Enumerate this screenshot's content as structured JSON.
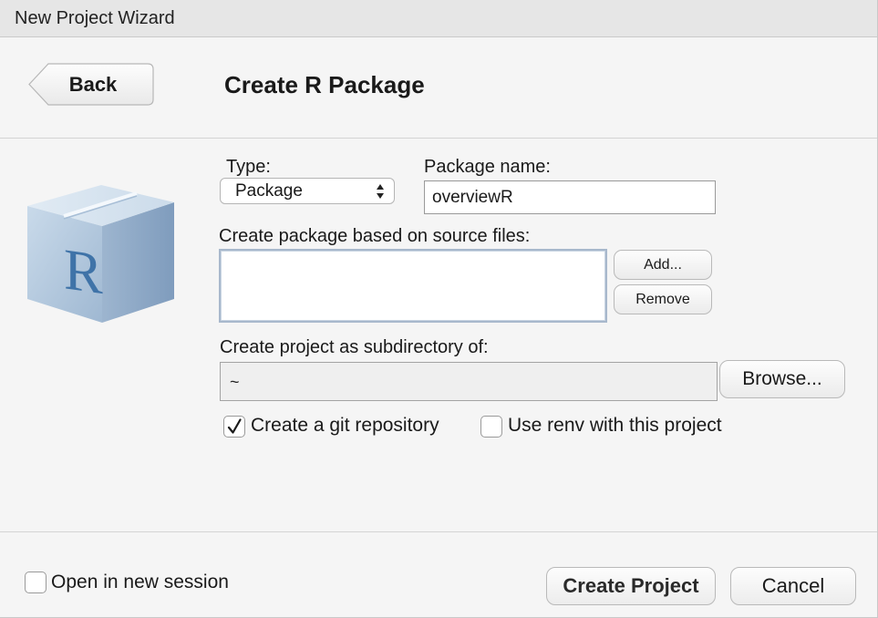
{
  "window": {
    "title": "New Project Wizard"
  },
  "header": {
    "back_label": "Back",
    "title": "Create R Package"
  },
  "logo": {
    "letter": "R"
  },
  "form": {
    "type_label": "Type:",
    "type_value": "Package",
    "package_name_label": "Package name:",
    "package_name_value": "overviewR",
    "source_files_label": "Create package based on source files:",
    "add_label": "Add...",
    "remove_label": "Remove",
    "subdir_label": "Create project as subdirectory of:",
    "subdir_value": "~",
    "browse_label": "Browse...",
    "git_label": "Create a git repository",
    "git_checked": true,
    "renv_label": "Use renv with this project",
    "renv_checked": false
  },
  "footer": {
    "new_session_label": "Open in new session",
    "new_session_checked": false,
    "create_label": "Create Project",
    "cancel_label": "Cancel"
  },
  "icons": {
    "back": "back-arrow-button-shape",
    "select": "updown-arrows-icon",
    "check": "checkmark-icon",
    "logo": "r-package-cube-icon"
  }
}
